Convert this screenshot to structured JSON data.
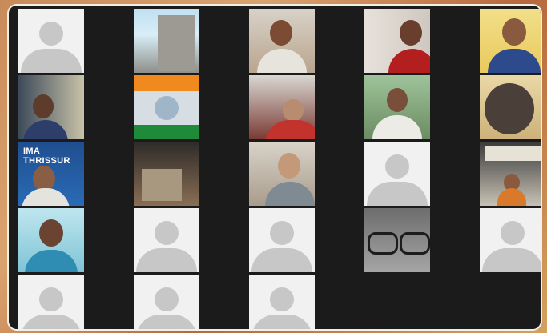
{
  "meeting": {
    "tiles": [
      {
        "name": "participant-tile-1",
        "kind": "placeholder"
      },
      {
        "name": "participant-tile-2",
        "kind": "video",
        "scene": "building"
      },
      {
        "name": "participant-tile-3",
        "kind": "video",
        "scene": "man-bookshelf"
      },
      {
        "name": "participant-tile-4",
        "kind": "video",
        "scene": "man-curtain"
      },
      {
        "name": "participant-tile-5",
        "kind": "video",
        "scene": "man-yellow-wall"
      },
      {
        "name": "participant-tile-6",
        "kind": "video",
        "scene": "man-window"
      },
      {
        "name": "participant-tile-7",
        "kind": "video",
        "scene": "orange-green-banner"
      },
      {
        "name": "participant-tile-8",
        "kind": "video",
        "scene": "man-red-chair"
      },
      {
        "name": "participant-tile-9",
        "kind": "video",
        "scene": "man-white-shirt"
      },
      {
        "name": "participant-tile-10",
        "kind": "video",
        "scene": "head-closeup"
      },
      {
        "name": "participant-tile-11",
        "kind": "video",
        "scene": "ima-thrissur",
        "overlay_label": "IMA THRISSUR"
      },
      {
        "name": "participant-tile-12",
        "kind": "video",
        "scene": "room-interior"
      },
      {
        "name": "participant-tile-13",
        "kind": "video",
        "scene": "man-glasses"
      },
      {
        "name": "participant-tile-14",
        "kind": "placeholder"
      },
      {
        "name": "participant-tile-15",
        "kind": "video",
        "scene": "stage-event"
      },
      {
        "name": "participant-tile-16",
        "kind": "video",
        "scene": "surgeon-cap"
      },
      {
        "name": "participant-tile-17",
        "kind": "placeholder"
      },
      {
        "name": "participant-tile-18",
        "kind": "placeholder"
      },
      {
        "name": "participant-tile-19",
        "kind": "video",
        "scene": "glasses-closeup"
      },
      {
        "name": "participant-tile-20",
        "kind": "placeholder"
      },
      {
        "name": "participant-tile-21",
        "kind": "placeholder"
      },
      {
        "name": "participant-tile-22",
        "kind": "placeholder"
      },
      {
        "name": "participant-tile-23",
        "kind": "placeholder"
      }
    ]
  },
  "colors": {
    "placeholder_bg": "#f1f1f1",
    "avatar_gray": "#c7c7c7",
    "frame_bg": "#1b1b1b"
  }
}
